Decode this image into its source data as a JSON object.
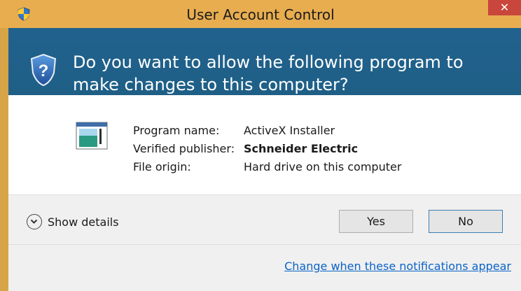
{
  "window": {
    "title": "User Account Control",
    "close_label": "✕",
    "title_icon": "uac-shield-icon"
  },
  "header": {
    "question": "Do you want to allow the following program to make changes to this computer?",
    "icon": "uac-question-shield-icon"
  },
  "program_info": {
    "icon": "program-window-icon",
    "labels": {
      "program_name": "Program name:",
      "verified_publisher": "Verified publisher:",
      "file_origin": "File origin:"
    },
    "values": {
      "program_name": "ActiveX Installer",
      "verified_publisher": "Schneider Electric",
      "file_origin": "Hard drive on this computer"
    }
  },
  "actions": {
    "show_details": "Show details",
    "details_icon": "chevron-down-circle-icon",
    "yes": "Yes",
    "no": "No"
  },
  "footer": {
    "link": "Change when these notifications appear"
  },
  "colors": {
    "titlebar": "#e8ad4f",
    "header_band": "#20628e",
    "close": "#c9463d",
    "link": "#0b63c7"
  }
}
